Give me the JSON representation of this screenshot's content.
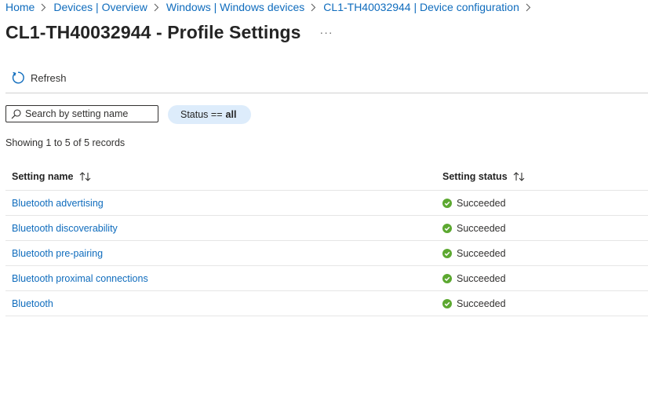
{
  "breadcrumb": [
    {
      "label": "Home"
    },
    {
      "label": "Devices | Overview"
    },
    {
      "label": "Windows | Windows devices"
    },
    {
      "label": "CL1-TH40032944 | Device configuration"
    }
  ],
  "header": {
    "title": "CL1-TH40032944 - Profile Settings",
    "more_label": "···"
  },
  "toolbar": {
    "refresh_label": "Refresh"
  },
  "filters": {
    "search_placeholder": "Search by setting name",
    "status_key": "Status ==",
    "status_value": "all"
  },
  "record_count": "Showing 1 to 5 of 5 records",
  "table": {
    "columns": [
      "Setting name",
      "Setting status"
    ],
    "rows": [
      {
        "name": "Bluetooth advertising",
        "status": "Succeeded"
      },
      {
        "name": "Bluetooth discoverability",
        "status": "Succeeded"
      },
      {
        "name": "Bluetooth pre-pairing",
        "status": "Succeeded"
      },
      {
        "name": "Bluetooth proximal connections",
        "status": "Succeeded"
      },
      {
        "name": "Bluetooth",
        "status": "Succeeded"
      }
    ]
  },
  "colors": {
    "link": "#0f6cbd",
    "success": "#5ca830",
    "pill_background": "#ddecfb"
  },
  "icons": {
    "refresh": "refresh-icon",
    "search": "search-icon",
    "sort": "sort-icon",
    "success": "success-check-icon",
    "chevron": "chevron-right-icon"
  }
}
